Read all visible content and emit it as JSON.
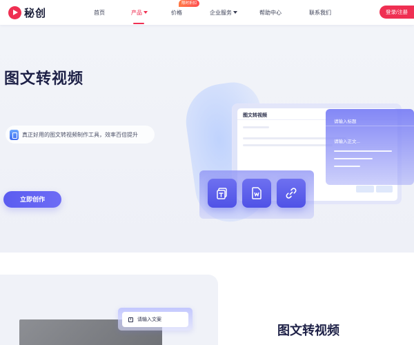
{
  "brand": {
    "name": "秘创",
    "accent": "#ef2f52"
  },
  "nav": {
    "items": [
      {
        "label": "首页",
        "active": false,
        "dropdown": false
      },
      {
        "label": "产品",
        "active": true,
        "dropdown": true
      },
      {
        "label": "价格",
        "active": false,
        "dropdown": false
      },
      {
        "label": "企业服务",
        "active": false,
        "dropdown": true
      },
      {
        "label": "帮助中心",
        "active": false,
        "dropdown": false
      },
      {
        "label": "联系我们",
        "active": false,
        "dropdown": false
      }
    ],
    "price_badge": "限时折扣",
    "login_label": "登录/注册"
  },
  "hero": {
    "title": "图文转视频",
    "tagline": "真正好用的图文转视频制作工具，效率百倍提升",
    "cta_label": "立即创作",
    "cta_color": "#5b5cf0"
  },
  "illustration": {
    "editor_title": "图文转视频",
    "title_placeholder": "请输入标题",
    "body_placeholder": "请输入正文...",
    "tiles": [
      "text-file-icon",
      "word-file-icon",
      "link-icon"
    ]
  },
  "section2": {
    "input_placeholder": "请输入文案",
    "title": "图文转视频"
  }
}
